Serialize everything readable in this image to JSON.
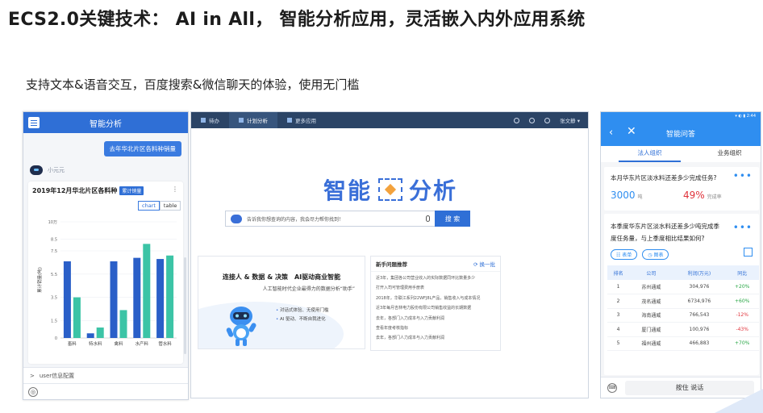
{
  "slide": {
    "title": "ECS2.0关键技术： AI in All， 智能分析应用，灵活嵌入内外应用系统",
    "subtitle": "支持文本&语音交互，百度搜索&微信聊天的体验，使用无门槛"
  },
  "mobile_analysis": {
    "header_title": "智能分析",
    "user_query": "去年华北片区各料种销量",
    "bot_name": "小元元",
    "card_title": "2019年12月华北片区各料种",
    "card_tag": "累计销量",
    "more": "⋮",
    "view_toggle": [
      "chart",
      "table"
    ],
    "footer_label": "user信息配置",
    "footer_chevron": ">",
    "voice_icon_glyph": "◎"
  },
  "chart_data": {
    "type": "bar",
    "categories": [
      "畜料",
      "特水料",
      "禽料",
      "水产料",
      "管水料"
    ],
    "ylabel": "累计销量(吨)",
    "ylim": [
      0,
      10
    ],
    "yticks": [
      "0",
      "1.5",
      "3.5",
      "5.5",
      "7.5",
      "8.5",
      "10万"
    ],
    "ytick_values": [
      0,
      1.5,
      3.5,
      5.5,
      7.5,
      8.5,
      10
    ],
    "series": [
      {
        "values": [
          6.6,
          0.4,
          6.6,
          6.9,
          6.8
        ],
        "color": "#2a5fc8"
      },
      {
        "values": [
          3.5,
          0.9,
          2.4,
          8.1,
          7.1
        ],
        "color": "#3cc4a6"
      }
    ]
  },
  "desktop": {
    "nav": [
      {
        "label": "待办",
        "active": false
      },
      {
        "label": "计划分析",
        "active": true
      },
      {
        "label": "更多应用",
        "active": false
      }
    ],
    "user": "张文静 ▾",
    "logo_left": "智能",
    "logo_right": "分析",
    "search_placeholder": "告诉我你想查询的内容，我会尽力帮你找到！",
    "search_button": "搜 索",
    "promo_title": "连接人 & 数据 & 决策　AI驱动商业智能",
    "promo_sub": "人工智能时代企业最得力的数据分析“助手”",
    "promo_bullets": [
      "对话式体验、无使用门槛",
      "AI 驱动、不断自我进化"
    ],
    "suggest_title": "新手问题推荐",
    "suggest_refresh": "⟳ 换一批",
    "suggest_list": [
      "近3年，集团各公司营业收入的实际数据同环比数量多少",
      "打开入司可管理费用手册表",
      "2018年，华联江系列22WFJ8L产品，销售收入与成本情况",
      "近3年每月吉林电力股份有限公司销售收益的长期数据",
      "去年，各部门入力成本与入力贡献利润",
      "查看年度考核指标",
      "去年，各部门人力成本与入力贡献利润"
    ]
  },
  "mobile_qa": {
    "status_time": "▾ ◐ ▮ 2:44",
    "header_title": "智能问答",
    "back_glyph": "‹",
    "close_glyph": "✕",
    "tabs": [
      {
        "label": "法人组织",
        "active": true
      },
      {
        "label": "业务组织",
        "active": false
      }
    ],
    "more_glyph": "•••",
    "q1": {
      "question": "本月华东片区淡水料还差多少完成任务?",
      "value": "3000",
      "unit": "吨",
      "pct": "49%",
      "pct_label": "完成率"
    },
    "q2": {
      "question_line1": "本季度华东片区淡水料还差多少吨完成季",
      "question_line2": "度任务量，与上季度相比结果如何?",
      "btn_table": "☷ 表单",
      "btn_chart": "◷ 图表",
      "columns": [
        "排名",
        "公司",
        "利润(万元)",
        "同比"
      ],
      "rows": [
        [
          "1",
          "苏州通威",
          "304,976",
          "+20%"
        ],
        [
          "2",
          "茂名通威",
          "6734,976",
          "+60%"
        ],
        [
          "3",
          "海南通威",
          "766,543",
          "-12%"
        ],
        [
          "4",
          "厦门通威",
          "100,976",
          "-43%"
        ],
        [
          "5",
          "福州通威",
          "466,883",
          "+70%"
        ]
      ]
    },
    "input_hint": "按住 说话",
    "keyboard_glyph": "⌨"
  },
  "colors": {
    "primary": "#2f6fd6",
    "nav_dark": "#2b4466",
    "mobile_blue": "#2f8ef0",
    "positive": "#28a745",
    "negative": "#e0333b"
  }
}
